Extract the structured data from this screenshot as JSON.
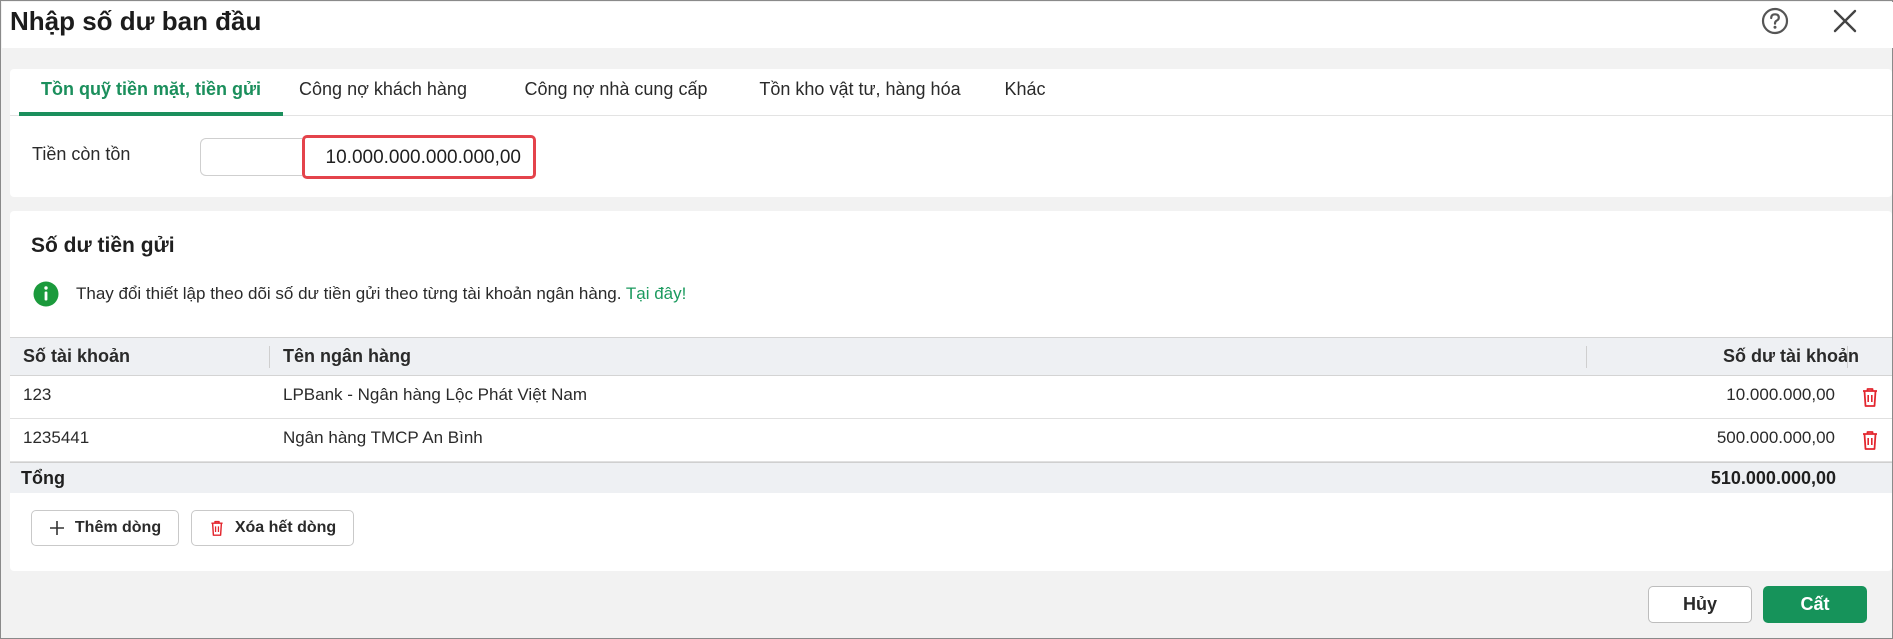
{
  "header": {
    "title": "Nhập số dư ban đầu"
  },
  "tabs": [
    {
      "label": "Tồn quỹ tiền mặt, tiền gửi",
      "active": true
    },
    {
      "label": "Công nợ khách hàng",
      "active": false
    },
    {
      "label": "Công nợ nhà cung cấp",
      "active": false
    },
    {
      "label": "Tồn kho vật tư, hàng hóa",
      "active": false
    },
    {
      "label": "Khác",
      "active": false
    }
  ],
  "cash": {
    "label": "Tiền còn tồn",
    "value": "10.000.000.000.000,00"
  },
  "deposit": {
    "title": "Số dư tiền gửi",
    "info_text": "Thay đổi thiết lập theo dõi số dư tiền gửi theo từng tài khoản ngân hàng.",
    "info_link": "Tại đây!",
    "columns": {
      "account": "Số tài khoản",
      "bank": "Tên ngân hàng",
      "balance": "Số dư tài khoản"
    },
    "rows": [
      {
        "account": "123",
        "bank": "LPBank - Ngân hàng Lộc Phát Việt Nam",
        "balance": "10.000.000,00"
      },
      {
        "account": "1235441",
        "bank": "Ngân hàng TMCP An Bình",
        "balance": "500.000.000,00"
      }
    ],
    "total_label": "Tổng",
    "total_value": "510.000.000,00",
    "add_row_label": "Thêm dòng",
    "clear_rows_label": "Xóa hết dòng"
  },
  "footer": {
    "cancel_label": "Hủy",
    "save_label": "Cất"
  },
  "colors": {
    "accent": "#1b8f5c",
    "danger": "#e4434b",
    "save": "#16935a"
  },
  "icons": [
    "help-icon",
    "close-icon",
    "info-icon",
    "trash-icon",
    "plus-icon"
  ]
}
